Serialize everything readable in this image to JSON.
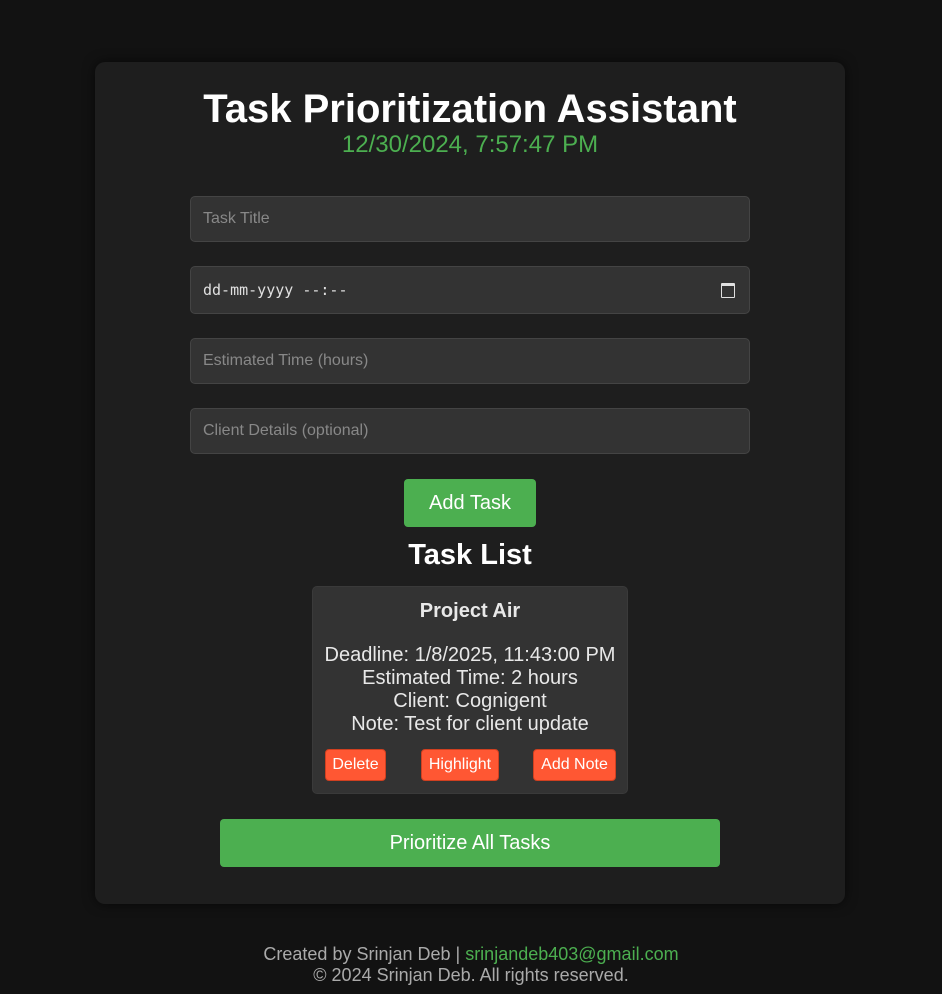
{
  "app": {
    "title": "Task Prioritization Assistant",
    "datetime": "12/30/2024, 7:57:47 PM"
  },
  "form": {
    "title_placeholder": "Task Title",
    "deadline_placeholder": "dd-mm-yyyy --:--",
    "time_placeholder": "Estimated Time (hours)",
    "client_placeholder": "Client Details (optional)",
    "add_button": "Add Task"
  },
  "task_list": {
    "heading": "Task List",
    "tasks": [
      {
        "name": "Project Air",
        "deadline": "Deadline: 1/8/2025, 11:43:00 PM",
        "estimated_time": "Estimated Time: 2 hours",
        "client": "Client: Cognigent",
        "note": "Note: Test for client update",
        "buttons": {
          "delete": "Delete",
          "highlight": "Highlight",
          "add_note": "Add Note"
        }
      }
    ]
  },
  "prioritize_button": "Prioritize All Tasks",
  "footer": {
    "credit": "Created by Srinjan Deb | ",
    "email": "srinjandeb403@gmail.com",
    "copyright": "© 2024 Srinjan Deb. All rights reserved."
  },
  "colors": {
    "page_bg": "#121212",
    "panel_bg": "#1e1e1e",
    "accent_green": "#4caf50",
    "action_orange": "#ff5733",
    "input_bg": "#333333"
  },
  "icons": {
    "deadline_picker": "calendar-icon"
  }
}
